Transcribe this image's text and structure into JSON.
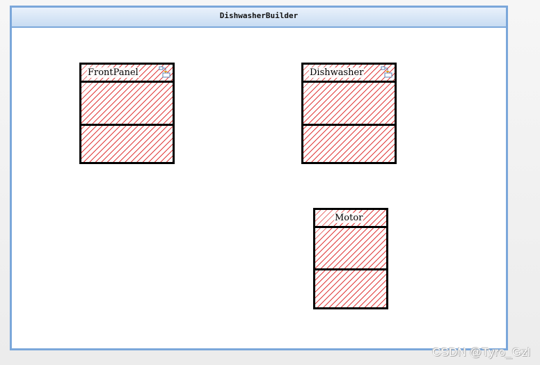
{
  "window": {
    "title": "DishwasherBuilder"
  },
  "classes": [
    {
      "name": "FrontPanel",
      "icon": "composite-structure-icon"
    },
    {
      "name": "Dishwasher",
      "icon": "composite-structure-icon"
    },
    {
      "name": "Motor"
    }
  ],
  "watermark": "CSDN @Tyro_Gzl",
  "colors": {
    "window_border": "#7ba7da",
    "hatch": "#e03b3b",
    "box_border": "#000000"
  }
}
